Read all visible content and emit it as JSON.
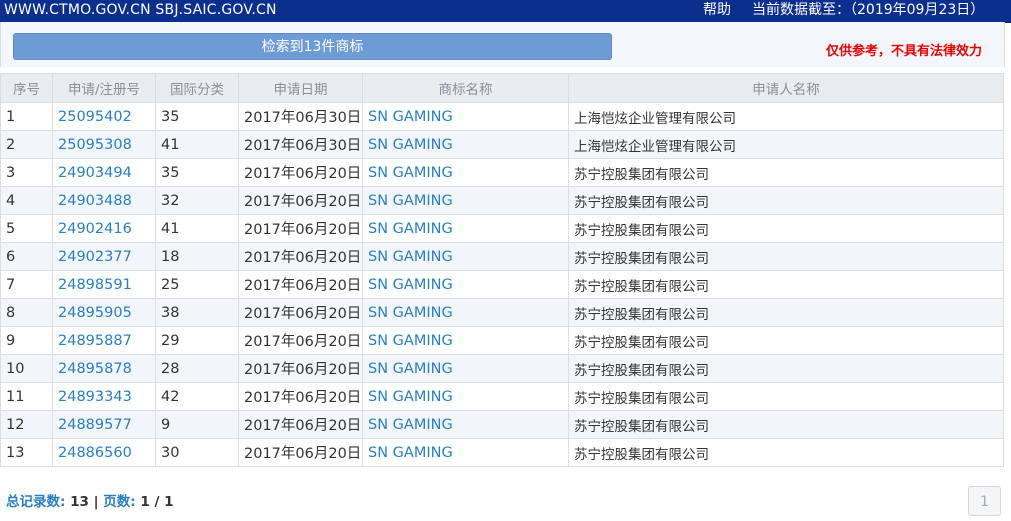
{
  "topbar": {
    "urls": "WWW.CTMO.GOV.CN SBJ.SAIC.GOV.CN",
    "help": "帮助",
    "data_date": "当前数据截至：（2019年09月23日）"
  },
  "search_panel": {
    "result_button": "检索到13件商标",
    "disclaimer": "仅供参考，不具有法律效力"
  },
  "table": {
    "headers": [
      "序号",
      "申请/注册号",
      "国际分类",
      "申请日期",
      "商标名称",
      "申请人名称"
    ],
    "rows": [
      {
        "no": "1",
        "reg_no": "25095402",
        "class": "35",
        "date": "2017年06月30日",
        "mark": "SN GAMING",
        "applicant": "上海恺炫企业管理有限公司"
      },
      {
        "no": "2",
        "reg_no": "25095308",
        "class": "41",
        "date": "2017年06月30日",
        "mark": "SN GAMING",
        "applicant": "上海恺炫企业管理有限公司"
      },
      {
        "no": "3",
        "reg_no": "24903494",
        "class": "35",
        "date": "2017年06月20日",
        "mark": "SN GAMING",
        "applicant": "苏宁控股集团有限公司"
      },
      {
        "no": "4",
        "reg_no": "24903488",
        "class": "32",
        "date": "2017年06月20日",
        "mark": "SN GAMING",
        "applicant": "苏宁控股集团有限公司"
      },
      {
        "no": "5",
        "reg_no": "24902416",
        "class": "41",
        "date": "2017年06月20日",
        "mark": "SN GAMING",
        "applicant": "苏宁控股集团有限公司"
      },
      {
        "no": "6",
        "reg_no": "24902377",
        "class": "18",
        "date": "2017年06月20日",
        "mark": "SN GAMING",
        "applicant": "苏宁控股集团有限公司"
      },
      {
        "no": "7",
        "reg_no": "24898591",
        "class": "25",
        "date": "2017年06月20日",
        "mark": "SN GAMING",
        "applicant": "苏宁控股集团有限公司"
      },
      {
        "no": "8",
        "reg_no": "24895905",
        "class": "38",
        "date": "2017年06月20日",
        "mark": "SN GAMING",
        "applicant": "苏宁控股集团有限公司"
      },
      {
        "no": "9",
        "reg_no": "24895887",
        "class": "29",
        "date": "2017年06月20日",
        "mark": "SN GAMING",
        "applicant": "苏宁控股集团有限公司"
      },
      {
        "no": "10",
        "reg_no": "24895878",
        "class": "28",
        "date": "2017年06月20日",
        "mark": "SN GAMING",
        "applicant": "苏宁控股集团有限公司"
      },
      {
        "no": "11",
        "reg_no": "24893343",
        "class": "42",
        "date": "2017年06月20日",
        "mark": "SN GAMING",
        "applicant": "苏宁控股集团有限公司"
      },
      {
        "no": "12",
        "reg_no": "24889577",
        "class": "9",
        "date": "2017年06月20日",
        "mark": "SN GAMING",
        "applicant": "苏宁控股集团有限公司"
      },
      {
        "no": "13",
        "reg_no": "24886560",
        "class": "30",
        "date": "2017年06月20日",
        "mark": "SN GAMING",
        "applicant": "苏宁控股集团有限公司"
      }
    ]
  },
  "footer": {
    "total_label": "总记录数:",
    "total_value": "13",
    "separator": "|",
    "pages_label": "页数:",
    "pages_value": "1 / 1",
    "page_button": "1"
  },
  "colors": {
    "topbar_bg": "#0b2f8e",
    "search_button": "#6d9bd6",
    "disclaimer_text": "#e60000",
    "link": "#2a7fc1"
  }
}
